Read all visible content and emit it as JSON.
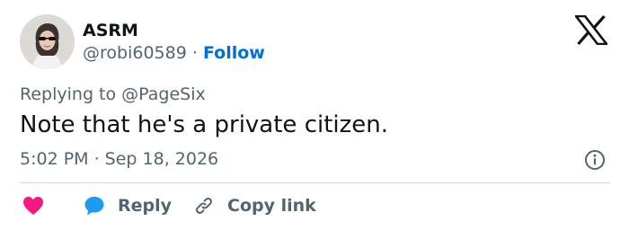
{
  "user": {
    "display_name": "ASRM",
    "handle": "@robi60589",
    "separator": "·",
    "follow_label": "Follow"
  },
  "tweet": {
    "replying_prefix": "Replying to",
    "replying_handle": "@PageSix",
    "text": "Note that he's a private citizen.",
    "timestamp": "5:02 PM · Sep 18, 2026"
  },
  "actions": {
    "reply_label": "Reply",
    "copy_link_label": "Copy link"
  },
  "icons": {
    "platform_logo": "x-logo-icon",
    "info": "info-icon",
    "like": "heart-icon",
    "reply": "speech-bubble-icon",
    "copy_link": "link-icon"
  },
  "colors": {
    "text_primary": "#0f1419",
    "text_secondary": "#536471",
    "follow_link": "#006fd6",
    "heart": "#f91880",
    "reply_bubble": "#1d9bf0",
    "divider": "#cfd9de"
  }
}
